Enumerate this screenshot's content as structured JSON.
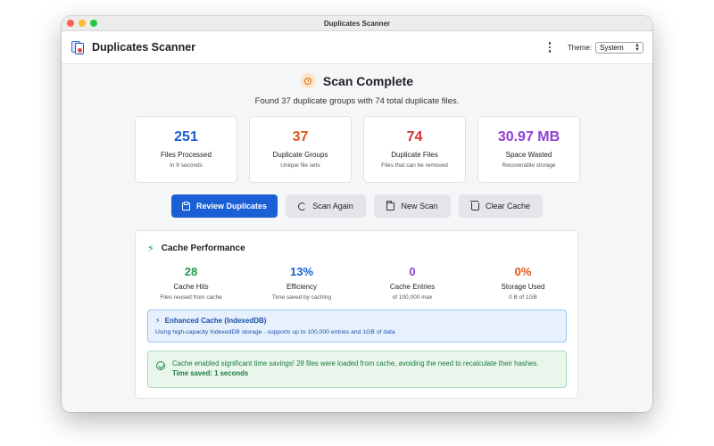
{
  "window": {
    "title": "Duplicates Scanner"
  },
  "header": {
    "app_name": "Duplicates Scanner",
    "theme_label": "Theme:",
    "theme_value": "System"
  },
  "status": {
    "title": "Scan Complete",
    "summary": "Found 37 duplicate groups with 74 total duplicate files."
  },
  "stats": [
    {
      "value": "251",
      "label": "Files Processed",
      "sub": "In 9 seconds",
      "color": "#1a5fd6"
    },
    {
      "value": "37",
      "label": "Duplicate Groups",
      "sub": "Unique file sets",
      "color": "#e2531c"
    },
    {
      "value": "74",
      "label": "Duplicate Files",
      "sub": "Files that can be removed",
      "color": "#d63030"
    },
    {
      "value": "30.97 MB",
      "label": "Space Wasted",
      "sub": "Recoverable storage",
      "color": "#8e3fd6"
    }
  ],
  "actions": {
    "review": "Review Duplicates",
    "scan_again": "Scan Again",
    "new_scan": "New Scan",
    "clear_cache": "Clear Cache"
  },
  "cache": {
    "title": "Cache Performance",
    "stats": [
      {
        "value": "28",
        "label": "Cache Hits",
        "sub": "Files reused from cache",
        "color": "#1f9d55"
      },
      {
        "value": "13%",
        "label": "Efficiency",
        "sub": "Time saved by caching",
        "color": "#1a5fd6"
      },
      {
        "value": "0",
        "label": "Cache Entries",
        "sub": "of 100,000 max",
        "color": "#8e3fd6"
      },
      {
        "value": "0%",
        "label": "Storage Used",
        "sub": "0 B of 1GB",
        "color": "#e2531c"
      }
    ],
    "info_title": "Enhanced Cache (IndexedDB)",
    "info_text": "Using high-capacity IndexedDB storage - supports up to 100,000 entries and 1GB of data",
    "success_text": "Cache enabled significant time savings! 28 files were loaded from cache, avoiding the need to recalculate their hashes.",
    "success_time": "Time saved: 1 seconds"
  }
}
